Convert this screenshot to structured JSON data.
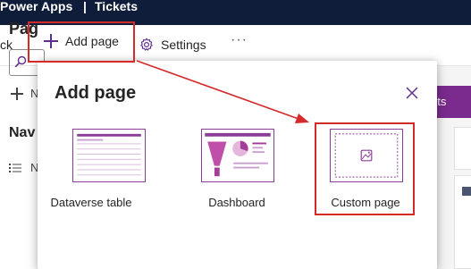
{
  "topbar": {
    "app_name": "Power Apps",
    "separator": "|",
    "breadcrumb": "Tickets"
  },
  "cmdbar": {
    "back_label": "ck",
    "add_page_label": "Add page",
    "settings_label": "Settings",
    "more_label": "···"
  },
  "left_panel": {
    "title": "Pag",
    "new_label": "N",
    "nav_heading": "Nav",
    "nav_item_label": "N"
  },
  "right_panel": {
    "tab_label": "ets"
  },
  "dialog": {
    "title": "Add page",
    "options": [
      {
        "label": "Dataverse table",
        "icon": "table-thumbnail"
      },
      {
        "label": "Dashboard",
        "icon": "dashboard-thumbnail"
      },
      {
        "label": "Custom page",
        "icon": "custom-page-thumbnail"
      }
    ]
  },
  "colors": {
    "accent": "#7a2b8e",
    "highlight": "#d42a2a",
    "topbar": "#0f1d3a"
  }
}
